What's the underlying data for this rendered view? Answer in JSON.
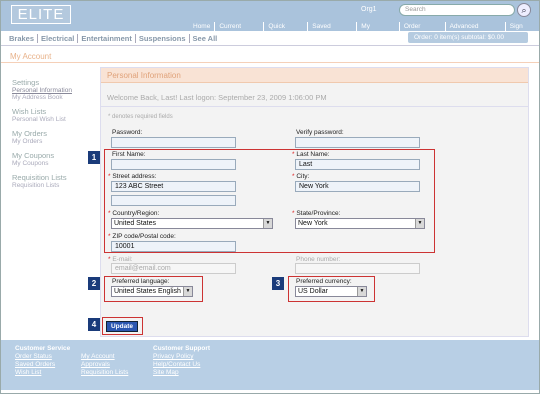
{
  "header": {
    "logo": "ELITE",
    "org": "Org1",
    "search_placeholder": "Search",
    "nav": [
      "Home",
      "Current Order",
      "Quick Order",
      "Saved Orders",
      "My Account",
      "Order Status",
      "Advanced Search",
      "Sign Out"
    ]
  },
  "categories": [
    "Brakes",
    "Electrical",
    "Entertainment",
    "Suspensions",
    "See All"
  ],
  "order_summary": "Order: 0 item(s) subtotal: $0.00",
  "page_title": "My Account",
  "sidebar": {
    "groups": [
      {
        "title": "Settings",
        "links": [
          "Personal Information",
          "My Address Book"
        ]
      },
      {
        "title": "Wish Lists",
        "links": [
          "Personal Wish List"
        ]
      },
      {
        "title": "My Orders",
        "links": [
          "My Orders"
        ]
      },
      {
        "title": "My Coupons",
        "links": [
          "My Coupons"
        ]
      },
      {
        "title": "Requisition Lists",
        "links": [
          "Requisition Lists"
        ]
      }
    ]
  },
  "panel": {
    "title": "Personal Information",
    "welcome": "Welcome Back, Last! Last logon: September 23, 2009 1:06:00 PM",
    "required_note": "* denotes required fields"
  },
  "form": {
    "password_label": "Password:",
    "verify_password_label": "Verify password:",
    "first_name_label": "First Name:",
    "first_name_value": "",
    "last_name_label": "Last Name:",
    "last_name_value": "Last",
    "street_label": "Street address:",
    "street_value": "123 ABC Street",
    "street2_value": "",
    "city_label": "City:",
    "city_value": "New York",
    "country_label": "Country/Region:",
    "country_value": "United States",
    "state_label": "State/Province:",
    "state_value": "New York",
    "zip_label": "ZIP code/Postal code:",
    "zip_value": "10001",
    "email_label": "E-mail:",
    "email_value": "email@email.com",
    "phone_label": "Phone number:",
    "phone_value": "",
    "language_label": "Preferred language:",
    "language_value": "United States English",
    "currency_label": "Preferred currency:",
    "currency_value": "US Dollar",
    "update_label": "Update"
  },
  "callouts": [
    "1",
    "2",
    "3",
    "4"
  ],
  "footer": {
    "col1_title": "Customer Service",
    "col1_links": [
      "Order Status",
      "Saved Orders",
      "Wish List"
    ],
    "col2_links": [
      "My Account",
      "Approvals",
      "Requisition Lists"
    ],
    "col3_title": "Customer Support",
    "col3_links": [
      "Privacy Policy",
      "Help/Contact Us",
      "Site Map"
    ]
  }
}
